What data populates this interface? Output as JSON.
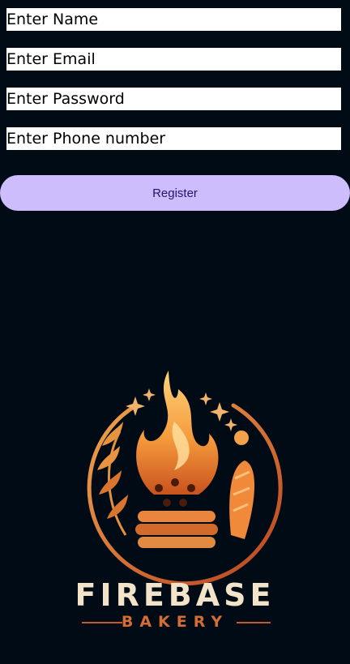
{
  "form": {
    "name_placeholder": "Enter Name",
    "email_placeholder": "Enter Email",
    "password_placeholder": "Enter Password",
    "phone_placeholder": "Enter Phone number",
    "register_label": "Register"
  },
  "logo": {
    "title": "FIREBASE",
    "subtitle": "BAKERY",
    "icon": "flame-bakery-emblem-icon"
  },
  "colors": {
    "background": "#000b16",
    "button": "#cdbdfd",
    "button_text": "#28136a",
    "logo_cream": "#f3e3c8",
    "logo_orange": "#d36d33"
  }
}
